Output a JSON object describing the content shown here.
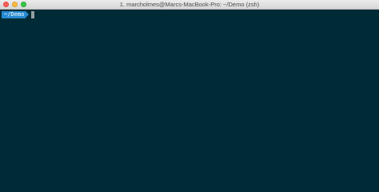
{
  "window": {
    "title": "1. marcholmes@Marcs-MacBook-Pro: ~/Demo (zsh)"
  },
  "terminal": {
    "prompt_dir": "~/Demo",
    "background_color": "#002b36",
    "prompt_segment_color": "#268bd2",
    "cursor_color": "#93a1a1"
  },
  "titlebar": {
    "buttons": [
      "close-button",
      "minimize-button",
      "zoom-button"
    ]
  }
}
